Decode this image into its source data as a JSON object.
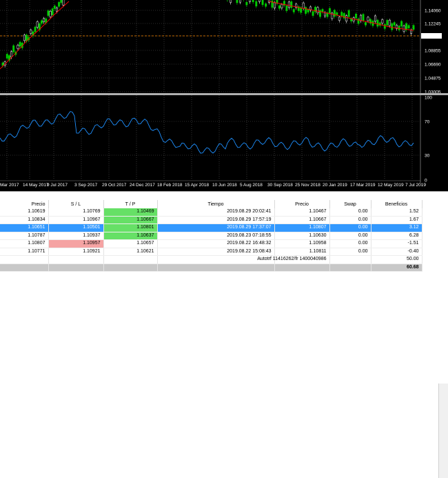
{
  "chart": {
    "price_labels": [
      "1.14060",
      "1.12245",
      "1.10533",
      "1.08855",
      "1.06690",
      "1.04875",
      "1.03005"
    ],
    "current_price": "1.10533",
    "indicator_labels": [
      "100",
      "70",
      "30",
      "0"
    ],
    "time_labels": [
      "Mar 2017",
      "14 May 2017",
      "9 Jul 2017",
      "3 Sep 2017",
      "29 Oct 2017",
      "24 Dec 2017",
      "18 Feb 2018",
      "15 Apr 2018",
      "10 Jun 2018",
      "5 Aug 2018",
      "30 Sep 2018",
      "25 Nov 2018",
      "20 Jan 2019",
      "17 Mar 2019",
      "12 May 2019",
      "7 Jul 2019"
    ],
    "colors": {
      "bull_candle": "#00cc00",
      "bear_candle": "#ffffff",
      "ma_line": "#ff0000",
      "indicator_line": "#1e90ff",
      "price_line": "#ff8c00"
    },
    "icons": {
      "separator": "split-handle-icon"
    }
  },
  "terminal": {
    "headers": [
      "Precio",
      "S / L",
      "T / P",
      "Tiempo",
      "Precio",
      "Swap",
      "Beneficios"
    ],
    "rows": [
      {
        "precio": "1.10619",
        "sl": "1.10769",
        "tp": "1.10469",
        "tiempo": "2019.08.29 20:02:41",
        "precio2": "1.10467",
        "swap": "0.00",
        "beneficios": "1.52",
        "tp_hit": true,
        "sl_hit": false,
        "selected": false
      },
      {
        "precio": "1.10834",
        "sl": "1.10967",
        "tp": "1.10667",
        "tiempo": "2019.08.29 17:57:19",
        "precio2": "1.10667",
        "swap": "0.00",
        "beneficios": "1.67",
        "tp_hit": true,
        "sl_hit": false,
        "selected": false
      },
      {
        "precio": "1.10651",
        "sl": "1.10501",
        "tp": "1.10801",
        "tiempo": "2019.08.29 17:37:07",
        "precio2": "1.10807",
        "swap": "0.00",
        "beneficios": "3.12",
        "tp_hit": true,
        "sl_hit": false,
        "selected": true
      },
      {
        "precio": "1.10787",
        "sl": "1.10937",
        "tp": "1.10637",
        "tiempo": "2019.08.23 07:18:55",
        "precio2": "1.10630",
        "swap": "0.00",
        "beneficios": "6.28",
        "tp_hit": true,
        "sl_hit": false,
        "selected": false
      },
      {
        "precio": "1.10807",
        "sl": "1.10957",
        "tp": "1.10657",
        "tiempo": "2019.08.22 16:48:32",
        "precio2": "1.10958",
        "swap": "0.00",
        "beneficios": "-1.51",
        "tp_hit": false,
        "sl_hit": true,
        "selected": false
      },
      {
        "precio": "1.10771",
        "sl": "1.10921",
        "tp": "1.10621",
        "tiempo": "2019.08.22 15:08:43",
        "precio2": "1.10811",
        "swap": "0.00",
        "beneficios": "-0.40",
        "tp_hit": false,
        "sl_hit": false,
        "selected": false
      }
    ],
    "summary_label": "Autotrf 11416262/fr 1400040986",
    "summary_value": "50.00",
    "total": "60.68"
  }
}
